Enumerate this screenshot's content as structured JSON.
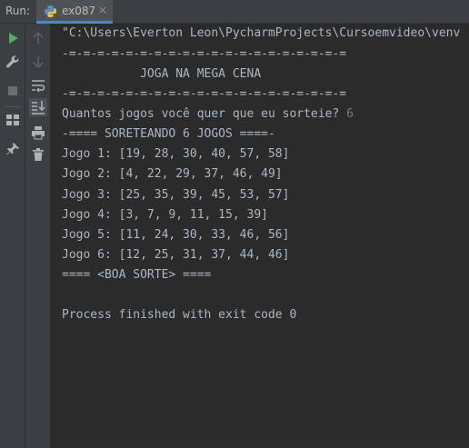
{
  "run_panel": {
    "label": "Run:",
    "tab": {
      "title": "ex087",
      "close": "×"
    }
  },
  "toolbar": {
    "outer": [
      "rerun-icon",
      "wrench-icon",
      "stop-icon",
      "layout-icon",
      "pin-icon"
    ],
    "inner": [
      "arrow-up-icon",
      "arrow-down-icon",
      "soft-wrap-icon",
      "scroll-to-end-icon",
      "print-icon",
      "trash-icon"
    ]
  },
  "colors": {
    "panel": "#3c3f41",
    "console_bg": "#2b2b2b",
    "text": "#a9b7c6",
    "user_input": "#6a8759",
    "accent": "#4a88c7",
    "run_green": "#59a869"
  },
  "console": {
    "lines": [
      "\"C:\\Users\\Everton Leon\\PycharmProjects\\Cursoemvideo\\venv",
      "-=-=-=-=-=-=-=-=-=-=-=-=-=-=-=-=-=-=-=-=",
      "           JOGA NA MEGA CENA",
      "-=-=-=-=-=-=-=-=-=-=-=-=-=-=-=-=-=-=-=-=",
      "Quantos jogos você quer que eu sorteie? ",
      "-==== SORETEANDO 6 JOGOS ====-",
      "Jogo 1: [19, 28, 30, 40, 57, 58]",
      "Jogo 2: [4, 22, 29, 37, 46, 49]",
      "Jogo 3: [25, 35, 39, 45, 53, 57]",
      "Jogo 4: [3, 7, 9, 11, 15, 39]",
      "Jogo 5: [11, 24, 30, 33, 46, 56]",
      "Jogo 6: [12, 25, 31, 37, 44, 46]",
      "==== <BOA SORTE> ====",
      "",
      "Process finished with exit code 0"
    ],
    "user_input": "6"
  }
}
